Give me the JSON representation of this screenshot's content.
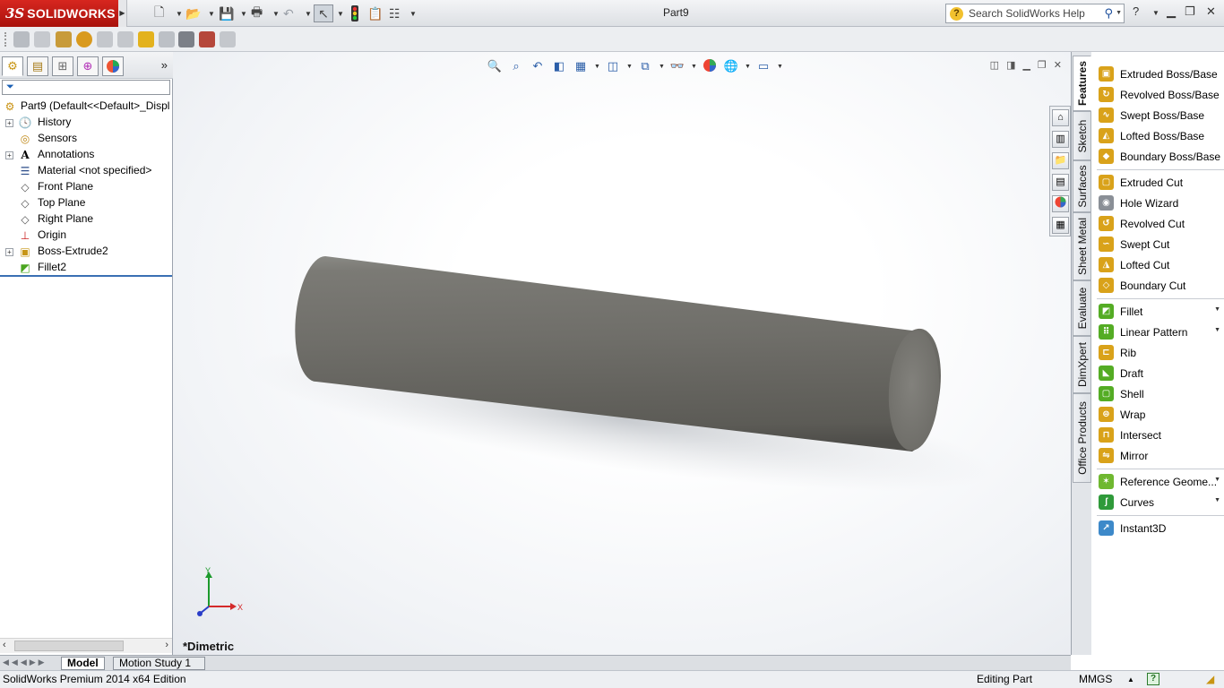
{
  "app": {
    "logo_prefix": "3S",
    "logo_name": "SOLIDWORKS",
    "document_title": "Part9"
  },
  "search": {
    "placeholder": "Search SolidWorks Help",
    "help_icon": "help-question-icon"
  },
  "feature_manager": {
    "tabs": [
      "featuremanager-tree-icon",
      "propertymanager-icon",
      "configurationmanager-icon",
      "dimxpertmanager-icon",
      "displaymanager-icon"
    ],
    "root_label": "Part9  (Default<<Default>_Displ",
    "items": [
      {
        "label": "History",
        "icon": "history-folder-icon",
        "expandable": true
      },
      {
        "label": "Sensors",
        "icon": "sensors-folder-icon",
        "expandable": false
      },
      {
        "label": "Annotations",
        "icon": "annotations-icon",
        "expandable": true
      },
      {
        "label": "Material <not specified>",
        "icon": "material-icon",
        "expandable": false
      },
      {
        "label": "Front Plane",
        "icon": "plane-icon",
        "expandable": false
      },
      {
        "label": "Top Plane",
        "icon": "plane-icon",
        "expandable": false
      },
      {
        "label": "Right Plane",
        "icon": "plane-icon",
        "expandable": false
      },
      {
        "label": "Origin",
        "icon": "origin-icon",
        "expandable": false
      },
      {
        "label": "Boss-Extrude2",
        "icon": "boss-extrude-icon",
        "expandable": true
      },
      {
        "label": "Fillet2",
        "icon": "fillet-icon",
        "expandable": false
      }
    ]
  },
  "viewport": {
    "view_label": "*Dimetric",
    "triad": {
      "x_label": "X",
      "y_label": "Y"
    },
    "model_color": "#6f6e69"
  },
  "command_manager": {
    "tabs": [
      "Features",
      "Sketch",
      "Surfaces",
      "Sheet Metal",
      "Evaluate",
      "DimXpert",
      "Office Products"
    ],
    "active_tab": "Features",
    "features": [
      {
        "label": "Extruded Boss/Base",
        "icon": "extruded-boss-icon"
      },
      {
        "label": "Revolved Boss/Base",
        "icon": "revolved-boss-icon"
      },
      {
        "label": "Swept Boss/Base",
        "icon": "swept-boss-icon"
      },
      {
        "label": "Lofted Boss/Base",
        "icon": "lofted-boss-icon"
      },
      {
        "label": "Boundary Boss/Base",
        "icon": "boundary-boss-icon"
      },
      {
        "label": "Extruded Cut",
        "icon": "extruded-cut-icon"
      },
      {
        "label": "Hole Wizard",
        "icon": "hole-wizard-icon"
      },
      {
        "label": "Revolved Cut",
        "icon": "revolved-cut-icon"
      },
      {
        "label": "Swept Cut",
        "icon": "swept-cut-icon"
      },
      {
        "label": "Lofted Cut",
        "icon": "lofted-cut-icon"
      },
      {
        "label": "Boundary Cut",
        "icon": "boundary-cut-icon"
      },
      {
        "label": "Fillet",
        "icon": "fillet-icon",
        "dropdown": true
      },
      {
        "label": "Linear Pattern",
        "icon": "linear-pattern-icon",
        "dropdown": true
      },
      {
        "label": "Rib",
        "icon": "rib-icon"
      },
      {
        "label": "Draft",
        "icon": "draft-icon"
      },
      {
        "label": "Shell",
        "icon": "shell-icon"
      },
      {
        "label": "Wrap",
        "icon": "wrap-icon"
      },
      {
        "label": "Intersect",
        "icon": "intersect-icon"
      },
      {
        "label": "Mirror",
        "icon": "mirror-icon"
      },
      {
        "label": "Reference Geome...",
        "icon": "reference-geometry-icon",
        "dropdown": true
      },
      {
        "label": "Curves",
        "icon": "curves-icon",
        "dropdown": true
      },
      {
        "label": "Instant3D",
        "icon": "instant3d-icon"
      }
    ]
  },
  "bottom_tabs": [
    "Model",
    "Motion Study 1"
  ],
  "status": {
    "edition": "SolidWorks Premium 2014 x64 Edition",
    "mode": "Editing Part",
    "units": "MMGS"
  }
}
